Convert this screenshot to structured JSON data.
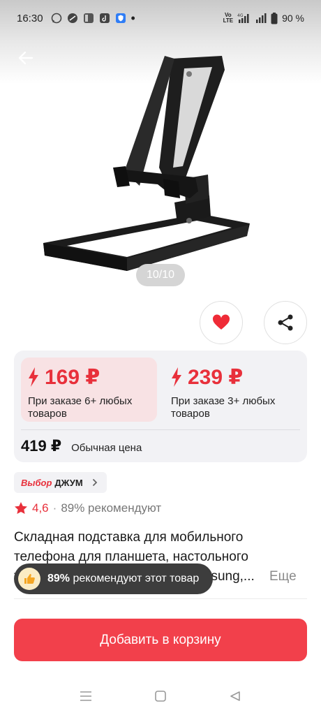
{
  "status_bar": {
    "time": "16:30",
    "network": "4G",
    "volte_line1": "Vo",
    "volte_line2": "LTE",
    "battery": "90 %"
  },
  "gallery": {
    "counter": "10/10"
  },
  "price_card": {
    "offers": [
      {
        "price": "169 ₽",
        "note_line1": "При заказе 6+ любых",
        "note_line2": "товаров"
      },
      {
        "price": "239 ₽",
        "note_line1": "При заказе 3+ любых",
        "note_line2": "товаров"
      }
    ],
    "regular_price": "419 ₽",
    "regular_label": "Обычная цена"
  },
  "badge": {
    "prefix": "Выбор",
    "name": "ДЖУМ"
  },
  "rating": {
    "value": "4,6",
    "recommend": "89% рекомендуют"
  },
  "product": {
    "title_line1": "Складная подставка для мобильного",
    "title_line2": "телефона для планшета, настольного",
    "title_line3": "телефона для iPad iPhone, Samsung,...",
    "more": "Еще"
  },
  "toast": {
    "percent": "89%",
    "text": "рекомендуют этот товар"
  },
  "cart_button": "Добавить в корзину",
  "colors": {
    "accent": "#f2404b",
    "price_red": "#e8303b",
    "offer_bg": "#f8e2e4",
    "card_bg": "#f2f2f5"
  }
}
